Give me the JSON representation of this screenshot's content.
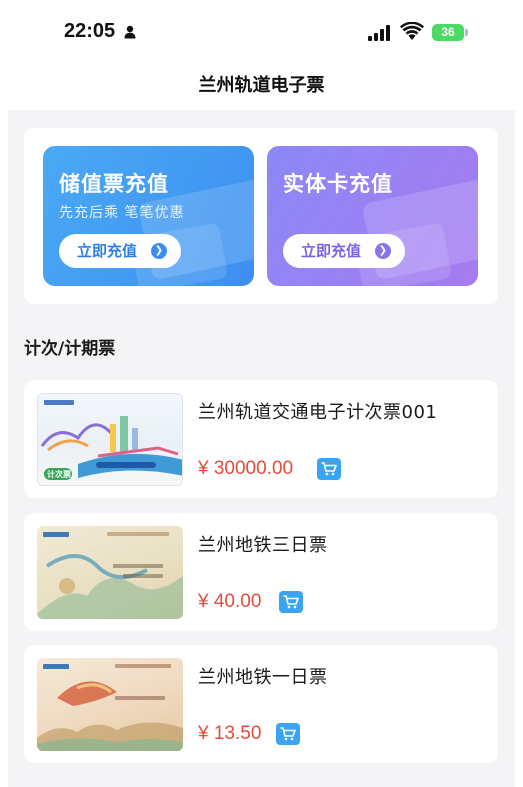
{
  "status": {
    "time": "22:05",
    "battery": "36"
  },
  "header": {
    "title": "兰州轨道电子票"
  },
  "recharge": [
    {
      "title": "储值票充值",
      "subtitle": "先充后乘   笔笔优惠",
      "button": "立即充值"
    },
    {
      "title": "实体卡充值",
      "subtitle": "",
      "button": "立即充值"
    }
  ],
  "section": {
    "title": "计次/计期票"
  },
  "tickets": [
    {
      "name": "兰州轨道交通电子计次票001",
      "price": "¥ 30000.00",
      "badge": "计次票"
    },
    {
      "name": "兰州地铁三日票",
      "price": "¥ 40.00"
    },
    {
      "name": "兰州地铁一日票",
      "price": "¥ 13.50"
    }
  ],
  "colors": {
    "price": "#e64b3c",
    "stored_tile": "#3d8ff0",
    "physical_tile": "#9a7ef2",
    "cart": "#39a5f2"
  }
}
